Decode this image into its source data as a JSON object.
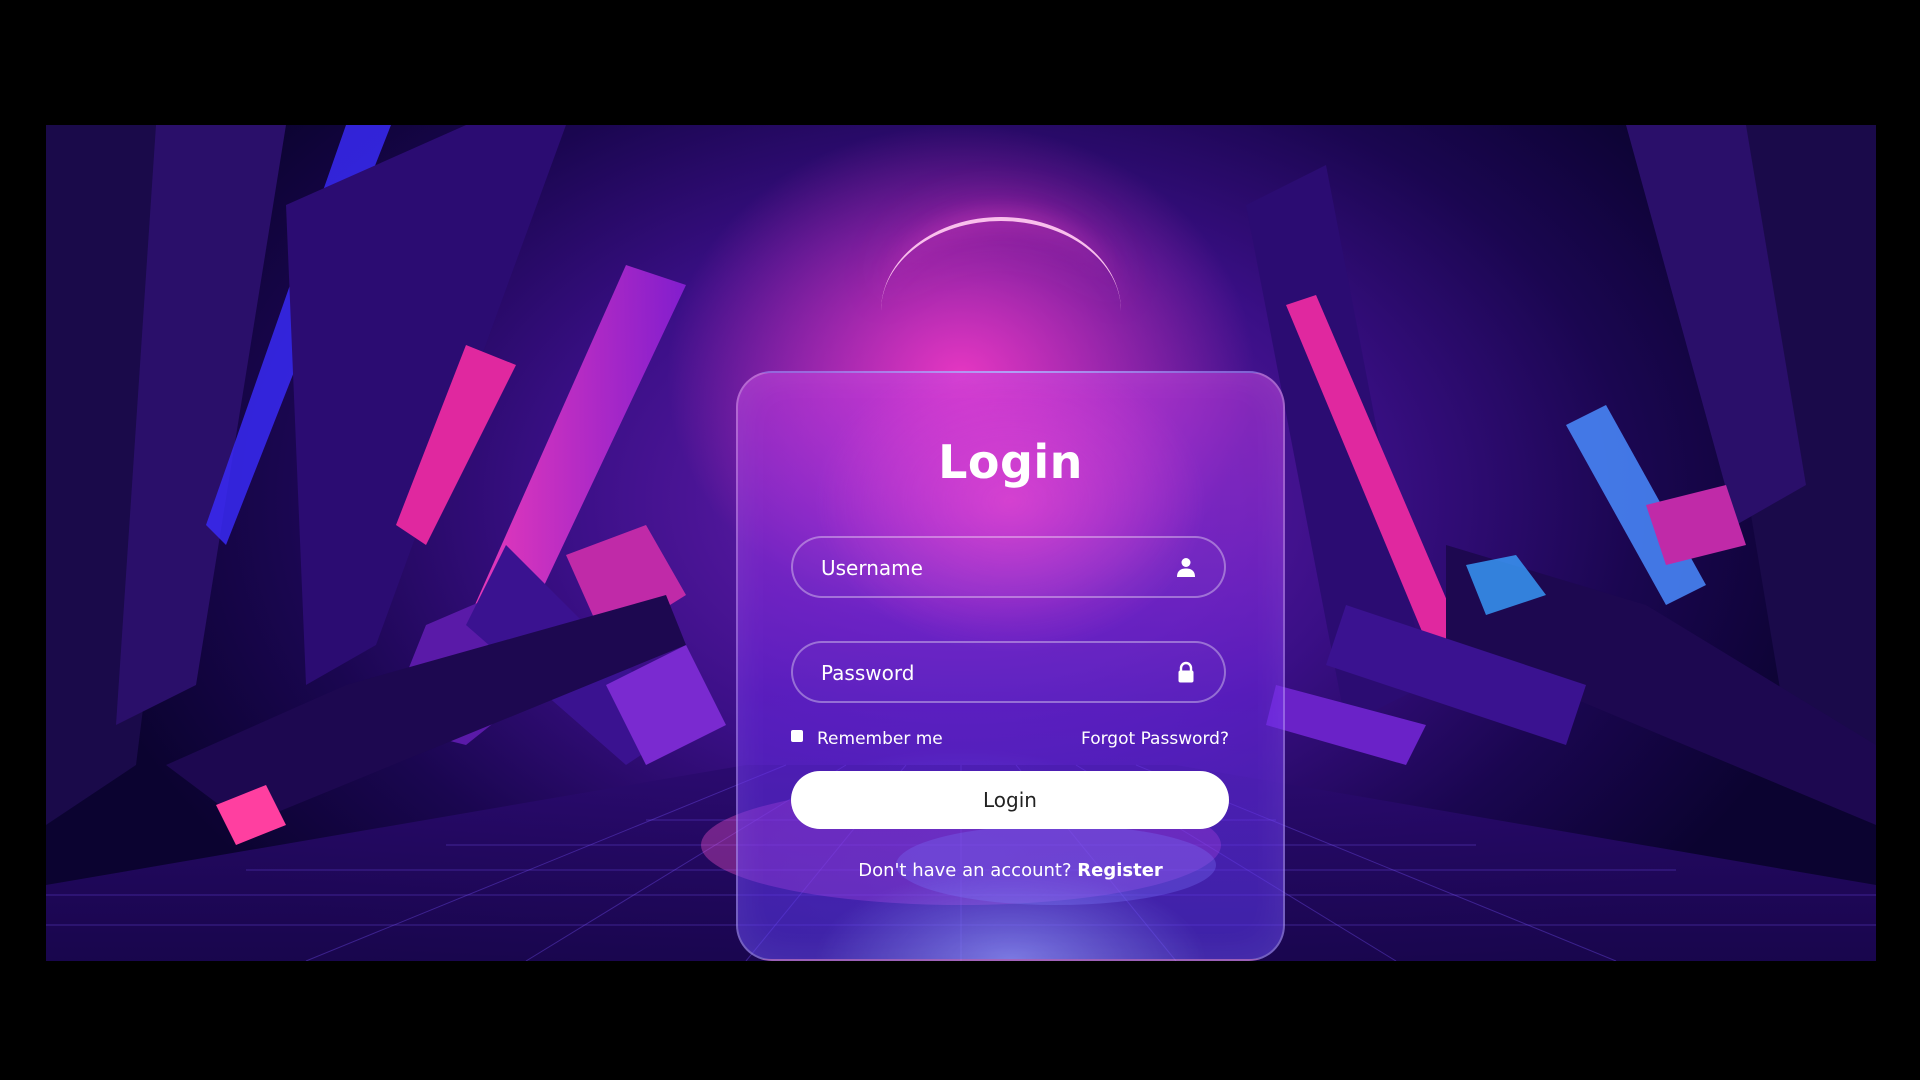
{
  "login_form": {
    "title": "Login",
    "username": {
      "placeholder": "Username",
      "icon": "user-icon"
    },
    "password": {
      "placeholder": "Password",
      "icon": "lock-icon"
    },
    "remember_label": "Remember me",
    "forgot_label": "Forgot Password?",
    "submit_label": "Login",
    "register_prompt": "Don't have an account?",
    "register_link": "Register"
  },
  "colors": {
    "page_background": "#000000",
    "accent_pink": "#ff2fb8",
    "accent_purple": "#6a1fb3",
    "button_background": "#ffffff",
    "button_text": "#222222",
    "text": "#ffffff"
  }
}
